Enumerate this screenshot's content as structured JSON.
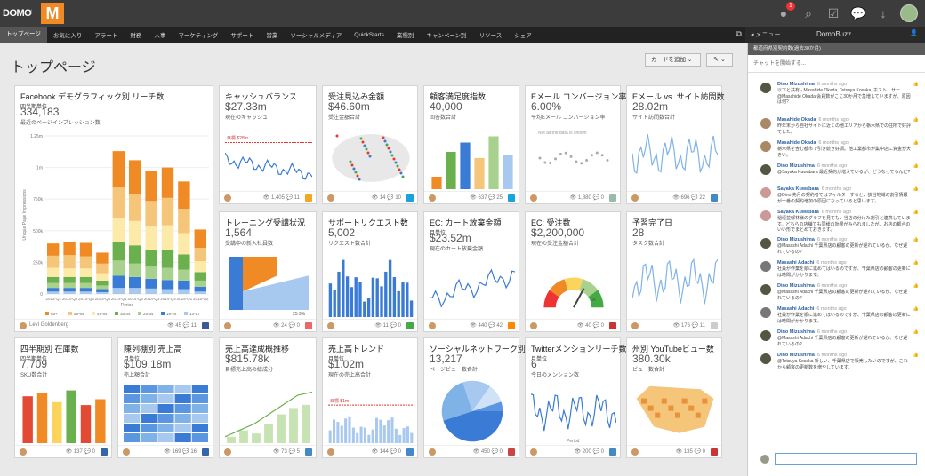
{
  "brand": {
    "logo": "DOMO",
    "plus": "+",
    "m": "M",
    "accent": "#f08a24"
  },
  "topbar": {
    "notif_count": "1"
  },
  "nav": {
    "items": [
      "トップページ",
      "お気に入り",
      "アラート",
      "財務",
      "人事",
      "マーケティング",
      "サポート",
      "営業",
      "ソーシャルメディア",
      "QuickStarts",
      "業種別",
      "キャンペーン別",
      "リソース",
      "シェア"
    ],
    "active": "トップページ"
  },
  "buzzbar": {
    "menu": "◂ メニュー",
    "title": "DomoBuzz"
  },
  "page": {
    "title": "トップページ",
    "add_card": "カードを追加",
    "add_card_caret": "⌄",
    "tools": "✎ ⌄"
  },
  "cards": [
    {
      "title": "Facebook デモグラフィック別 リーチ数",
      "sub": "四半期単位",
      "value": "334,183",
      "desc": "最近のページインプレッション数",
      "who": "Levi Goldenberg",
      "stats": "👁 45 💬 11"
    },
    {
      "title": "キャッシュバランス",
      "sub": "",
      "value": "$27.33m",
      "desc": "現在のキャッシュ",
      "who": "",
      "stats": "👁 1,405 💬 11"
    },
    {
      "title": "受注見込み金額",
      "sub": "",
      "value": "$46.60m",
      "desc": "受注金額合計",
      "who": "",
      "stats": "👁 14 💬 10"
    },
    {
      "title": "顧客満足度指数",
      "sub": "",
      "value": "40,000",
      "desc": "回答数合計",
      "who": "",
      "stats": "👁 637 💬 25"
    },
    {
      "title": "Eメール コンバージョン率",
      "sub": "",
      "value": "6.00%",
      "desc": "平均Eメール コンバージョン率",
      "who": "",
      "stats": "👁 1,380 💬 0"
    },
    {
      "title": "Eメール vs. サイト訪問数",
      "sub": "",
      "value": "28.02m",
      "desc": "サイト訪問数合計",
      "who": "",
      "stats": "👁 696 💬 22"
    },
    {
      "title": "トレーニング受講状況",
      "sub": "",
      "value": "1,564",
      "desc": "受講中の新入社員数",
      "who": "",
      "stats": "👁 24 💬 0"
    },
    {
      "title": "サポートリクエスト数",
      "sub": "",
      "value": "5,002",
      "desc": "リクエスト数合計",
      "who": "",
      "stats": "👁 11 💬 0"
    },
    {
      "title": "EC: カート放棄金額",
      "sub": "月単位",
      "value": "$23.52m",
      "desc": "現在のカート放棄金額",
      "who": "",
      "stats": "👁 440 💬 42"
    },
    {
      "title": "EC: 受注数",
      "sub": "",
      "value": "$2,200,000",
      "desc": "現在の受注金額合計",
      "who": "",
      "stats": "👁 40 💬 0"
    },
    {
      "title": "予習完了日",
      "sub": "",
      "value": "28",
      "desc": "タスク数合計",
      "who": "",
      "stats": "👁 176 💬 11"
    },
    {
      "title": "四半期別 在庫数",
      "sub": "四半期単位",
      "value": "7,709",
      "desc": "SKU数合計",
      "who": "",
      "stats": "👁 137 💬 0"
    },
    {
      "title": "陳列棚別 売上高",
      "sub": "月単位",
      "value": "$109.18m",
      "desc": "売上額合計",
      "who": "",
      "stats": "👁 169 💬 16"
    },
    {
      "title": "売上高達成概推移",
      "sub": "",
      "value": "$815.78k",
      "desc": "目標売上高の総成分",
      "who": "",
      "stats": "👁 73 💬 5"
    },
    {
      "title": "売上高トレンド",
      "sub": "月単位",
      "value": "$1.02m",
      "desc": "現在の売上高合計",
      "who": "",
      "stats": "👁 144 💬 0"
    },
    {
      "title": "ソーシャルネットワーク別...",
      "sub": "",
      "value": "13,217",
      "desc": "ページビュー数合計",
      "who": "",
      "stats": "👁 450 💬 0"
    },
    {
      "title": "Twitterメンションリーチ数",
      "sub": "月単位",
      "value": "6",
      "desc": "今日のメンション数",
      "who": "",
      "stats": "👁 200 💬 0"
    },
    {
      "title": "州別 YouTubeビュー数",
      "sub": "",
      "value": "380.30k",
      "desc": "ビュー数合計",
      "who": "",
      "stats": "👁 135 💬 0"
    }
  ],
  "chart_labels": {
    "fb_y": [
      "1.25m",
      "1m",
      "750k",
      "500k",
      "250k",
      "0"
    ],
    "fb_x": [
      "2013-Q1",
      "2013-Q2",
      "2013-Q3",
      "2013-Q4",
      "2014-Q1",
      "2014-Q2",
      "2014-Q3",
      "2014-Q4",
      "2015-Q1",
      "2015-Q2"
    ],
    "fb_legend": [
      "65+",
      "55-64",
      "45-54",
      "35-44",
      "25-34",
      "18-24",
      "13-17"
    ],
    "fb_xlabel": "Period",
    "fb_ylabel": "Unique Page Impressions",
    "cash_goal": "目標 $28m",
    "email_none": "Not all the data is shown",
    "train_pct": "25.9%",
    "gauge_label": "6K",
    "trend_goal": "目標 $1m",
    "tw_xlabel": "Period"
  },
  "buzz": {
    "channel": "都道府県別契約数(過去30か月)",
    "start": "チャットを開始する...",
    "messages": [
      {
        "name": "Dino Mizushima",
        "time": "6 months ago",
        "text": "以下と共有 - Masahide Okada, Tetsuya Kosaka, ホスト・サー @Masahide Okada 会員数がここ30か月で急増していますが、原因は何?"
      },
      {
        "name": "Masahide Okada",
        "time": "6 months ago",
        "text": "昨年末から自社サイトに近くの他エリアから栃木県での住所で好評でした。"
      },
      {
        "name": "Masahide Okada",
        "time": "6 months ago",
        "text": "栃木県を含む都市で引き続き好調。他工業都市が集中店に資金が大きい。"
      },
      {
        "name": "Dino Mizushima",
        "time": "6 months ago",
        "text": "@Sayaka Kuwabara 最近契約が増えているが、どうなってるんだ?"
      },
      {
        "name": "Sayaka Kuwabara",
        "time": "6 months ago",
        "text": "@Dino 先月の契約者ではフィルターすると、該当地域の割引情報が一番の契約増加の原因になっていると思います。"
      },
      {
        "name": "Sayaka Kuwabara",
        "time": "6 months ago",
        "text": "稲垣並郁林様のグラフを見ても、当店の分けた割引と連携しています。どちらの店舗でも同様の効果がみられましたが、お店の都合のいい形でまとめておきます。"
      },
      {
        "name": "Dino Mizushima",
        "time": "6 months ago",
        "text": "@Masashi Adachi 千葉県店の顧客の更新が遅れているが、なぜ遅れているの?"
      },
      {
        "name": "Masashi Adachi",
        "time": "6 months ago",
        "text": "社員が作業を順に進めてはいるのですが、千葉県店の顧客の更新には時間がかかります。"
      },
      {
        "name": "Dino Mizushima",
        "time": "6 months ago",
        "text": "@Masashi Adachi 千葉県店の顧客の更新が遅れているが、なぜ遅れているの?"
      },
      {
        "name": "Masashi Adachi",
        "time": "6 months ago",
        "text": "社員が作業を順に進めてはいるのですが、千葉県店の顧客の更新には時間がかかります。"
      },
      {
        "name": "Dino Mizushima",
        "time": "6 months ago",
        "text": "@Masashi Adachi 千葉県店の顧客の更新が遅れているが、なぜ遅れているの?"
      },
      {
        "name": "Dino Mizushima",
        "time": "6 months ago",
        "text": "@Tetsuya Kosaka 新しい、千葉県店で販売したいのですが、これから顧客の更新数を増やしています。"
      }
    ]
  }
}
